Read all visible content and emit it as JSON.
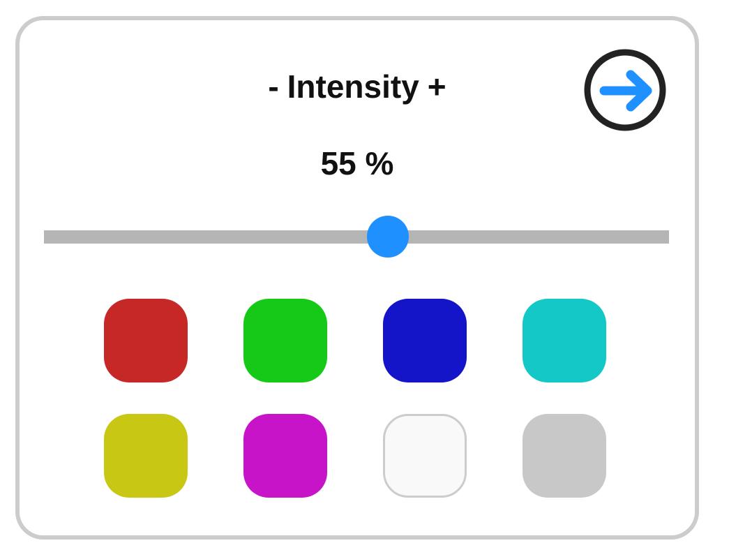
{
  "header": {
    "minus_label": "-",
    "title": "Intensity",
    "plus_label": "+"
  },
  "intensity": {
    "value": 55,
    "display": "55 %",
    "min": 0,
    "max": 100
  },
  "next_button": {
    "icon": "arrow-right-circle-icon",
    "ring_color": "#222222",
    "arrow_color": "#1e90ff"
  },
  "colors": {
    "accent": "#1e90ff",
    "track": "#b5b5b5",
    "panel_border": "#cccccc"
  },
  "swatches": [
    {
      "name": "red",
      "color": "#c62828"
    },
    {
      "name": "green",
      "color": "#16c916"
    },
    {
      "name": "blue",
      "color": "#1414c8"
    },
    {
      "name": "cyan",
      "color": "#14c8c8"
    },
    {
      "name": "yellow",
      "color": "#c8c814"
    },
    {
      "name": "magenta",
      "color": "#c814c8"
    },
    {
      "name": "white",
      "color": "#f9f9f9",
      "border": "#cccccc"
    },
    {
      "name": "gray",
      "color": "#c8c8c8"
    }
  ]
}
